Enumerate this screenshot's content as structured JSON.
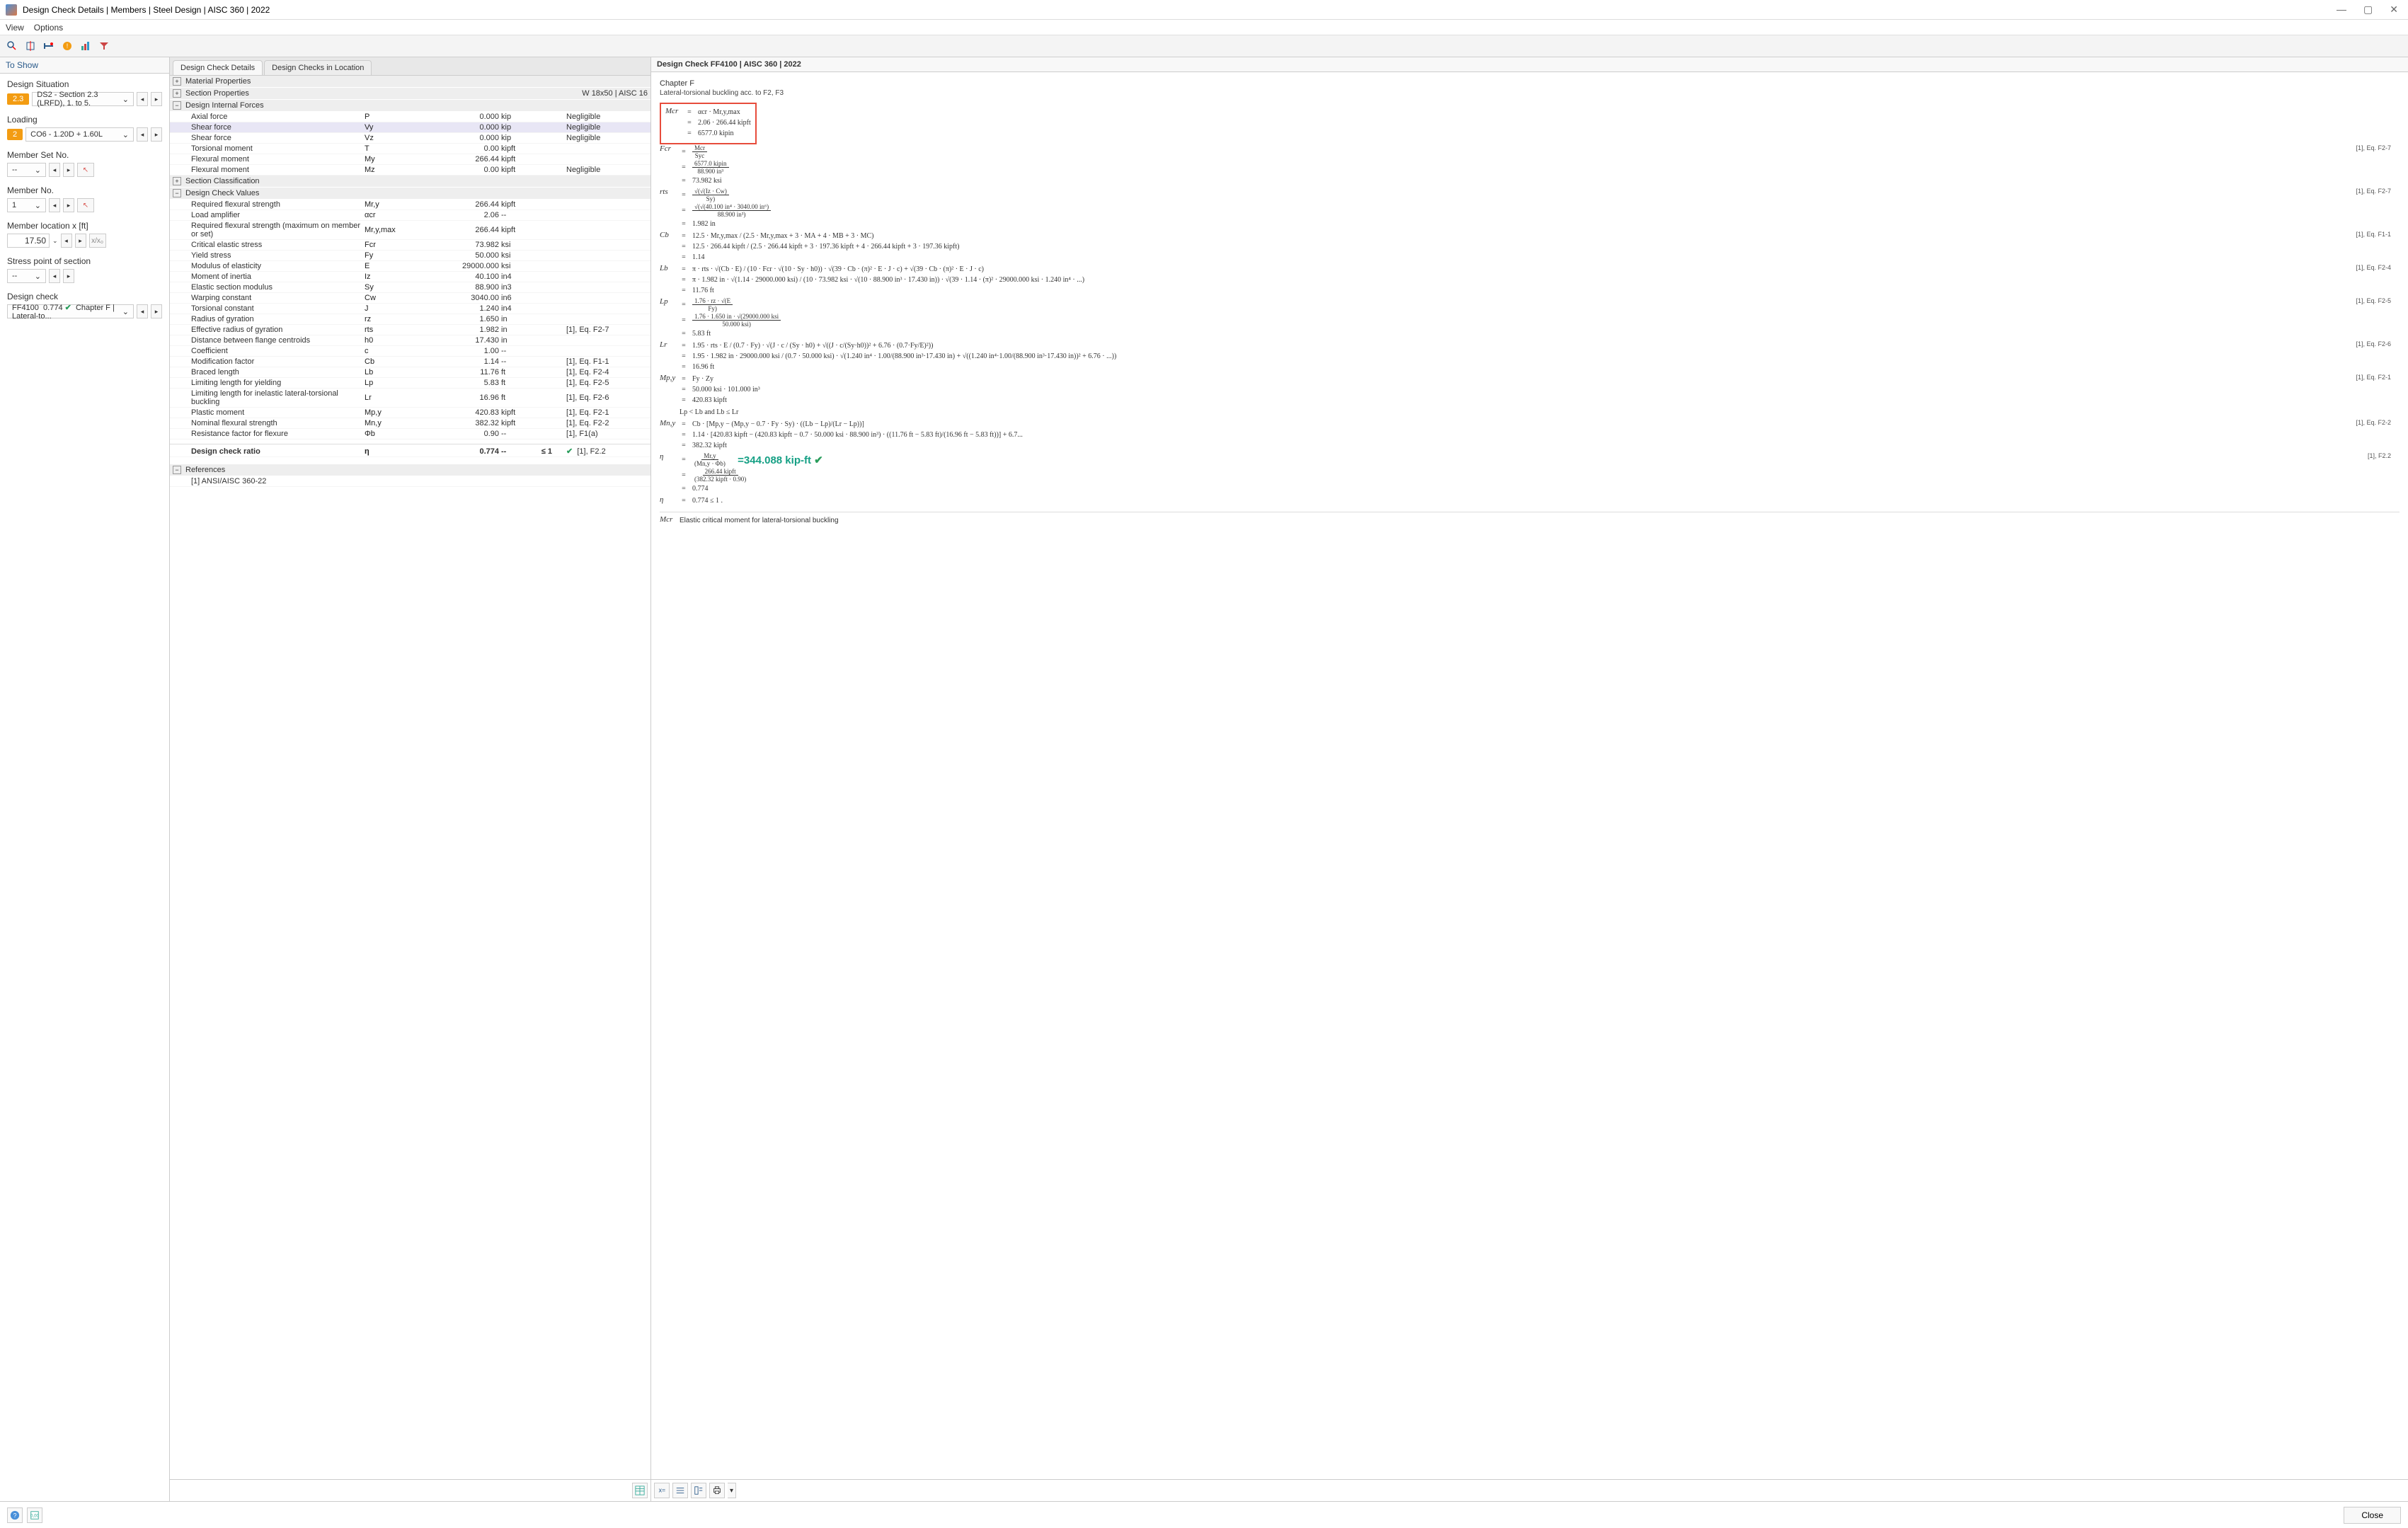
{
  "window": {
    "title": "Design Check Details | Members | Steel Design | AISC 360 | 2022"
  },
  "menu": {
    "view": "View",
    "options": "Options"
  },
  "sidebar": {
    "header": "To Show",
    "design_situation": {
      "label": "Design Situation",
      "chip": "2.3",
      "value": "DS2 - Section 2.3 (LRFD), 1. to 5."
    },
    "loading": {
      "label": "Loading",
      "chip": "2",
      "value": "CO6 - 1.20D + 1.60L"
    },
    "member_set": {
      "label": "Member Set No.",
      "value": "-- "
    },
    "member_no": {
      "label": "Member No.",
      "value": "1 "
    },
    "location": {
      "label": "Member location x [ft]",
      "value": "17.50"
    },
    "stress_point": {
      "label": "Stress point of section",
      "value": "-- "
    },
    "design_check": {
      "label": "Design check",
      "code": "FF4100",
      "ratio": "0.774",
      "desc": "Chapter F | Lateral-to..."
    }
  },
  "center": {
    "tabs": [
      "Design Check Details",
      "Design Checks in Location"
    ],
    "sections": {
      "material": "Material Properties",
      "section": "Section Properties",
      "section_right": "W 18x50 | AISC 16",
      "internal_forces": "Design Internal Forces",
      "section_class": "Section Classification",
      "check_values": "Design Check Values",
      "references": "References"
    },
    "internal_forces_rows": [
      {
        "label": "Axial force",
        "sym": "P",
        "val": "0.000",
        "unit": "kip",
        "note": "Negligible"
      },
      {
        "label": "Shear force",
        "sym": "Vy",
        "val": "0.000",
        "unit": "kip",
        "note": "Negligible",
        "hl": true
      },
      {
        "label": "Shear force",
        "sym": "Vz",
        "val": "0.000",
        "unit": "kip",
        "note": "Negligible"
      },
      {
        "label": "Torsional moment",
        "sym": "T",
        "val": "0.00",
        "unit": "kipft",
        "note": ""
      },
      {
        "label": "Flexural moment",
        "sym": "My",
        "val": "266.44",
        "unit": "kipft",
        "note": ""
      },
      {
        "label": "Flexural moment",
        "sym": "Mz",
        "val": "0.00",
        "unit": "kipft",
        "note": "Negligible"
      }
    ],
    "check_values_rows": [
      {
        "label": "Required flexural strength",
        "sym": "Mr,y",
        "val": "266.44",
        "unit": "kipft",
        "ref": ""
      },
      {
        "label": "Load amplifier",
        "sym": "αcr",
        "val": "2.06",
        "unit": "--",
        "ref": ""
      },
      {
        "label": "Required flexural strength (maximum on member or set)",
        "sym": "Mr,y,max",
        "val": "266.44",
        "unit": "kipft",
        "ref": ""
      },
      {
        "label": "Critical elastic stress",
        "sym": "Fcr",
        "val": "73.982",
        "unit": "ksi",
        "ref": ""
      },
      {
        "label": "Yield stress",
        "sym": "Fy",
        "val": "50.000",
        "unit": "ksi",
        "ref": ""
      },
      {
        "label": "Modulus of elasticity",
        "sym": "E",
        "val": "29000.000",
        "unit": "ksi",
        "ref": ""
      },
      {
        "label": "Moment of inertia",
        "sym": "Iz",
        "val": "40.100",
        "unit": "in4",
        "ref": ""
      },
      {
        "label": "Elastic section modulus",
        "sym": "Sy",
        "val": "88.900",
        "unit": "in3",
        "ref": ""
      },
      {
        "label": "Warping constant",
        "sym": "Cw",
        "val": "3040.00",
        "unit": "in6",
        "ref": ""
      },
      {
        "label": "Torsional constant",
        "sym": "J",
        "val": "1.240",
        "unit": "in4",
        "ref": ""
      },
      {
        "label": "Radius of gyration",
        "sym": "rz",
        "val": "1.650",
        "unit": "in",
        "ref": ""
      },
      {
        "label": "Effective radius of gyration",
        "sym": "rts",
        "val": "1.982",
        "unit": "in",
        "ref": "[1], Eq. F2-7"
      },
      {
        "label": "Distance between flange centroids",
        "sym": "h0",
        "val": "17.430",
        "unit": "in",
        "ref": ""
      },
      {
        "label": "Coefficient",
        "sym": "c",
        "val": "1.00",
        "unit": "--",
        "ref": ""
      },
      {
        "label": "Modification factor",
        "sym": "Cb",
        "val": "1.14",
        "unit": "--",
        "ref": "[1], Eq. F1-1"
      },
      {
        "label": "Braced length",
        "sym": "Lb",
        "val": "11.76",
        "unit": "ft",
        "ref": "[1], Eq. F2-4"
      },
      {
        "label": "Limiting length for yielding",
        "sym": "Lp",
        "val": "5.83",
        "unit": "ft",
        "ref": "[1], Eq. F2-5"
      },
      {
        "label": "Limiting length for inelastic lateral-torsional buckling",
        "sym": "Lr",
        "val": "16.96",
        "unit": "ft",
        "ref": "[1], Eq. F2-6"
      },
      {
        "label": "Plastic moment",
        "sym": "Mp,y",
        "val": "420.83",
        "unit": "kipft",
        "ref": "[1], Eq. F2-1"
      },
      {
        "label": "Nominal flexural strength",
        "sym": "Mn,y",
        "val": "382.32",
        "unit": "kipft",
        "ref": "[1], Eq. F2-2"
      },
      {
        "label": "Resistance factor for flexure",
        "sym": "Φb",
        "val": "0.90",
        "unit": "--",
        "ref": "[1], F1(a)"
      }
    ],
    "ratio": {
      "label": "Design check ratio",
      "sym": "η",
      "val": "0.774",
      "unit": "--",
      "limit": "≤ 1",
      "ref": "[1], F2.2"
    },
    "reference": "[1]  ANSI/AISC 360-22"
  },
  "right": {
    "header": "Design Check FF4100 | AISC 360 | 2022",
    "subtitle": "Chapter F",
    "subdesc": "Lateral-torsional buckling acc. to F2, F3",
    "boxed": {
      "lhs": "Mcr",
      "l1": "αcr · Mr,y,max",
      "l2": "2.06 · 266.44 kipft",
      "l3": "6577.0 kipin"
    },
    "eqs": [
      {
        "lhs": "Fcr",
        "ref": "[1], Eq. F2-7",
        "lines": [
          "Mcr / Syc",
          "6577.0 kipin / 88.900 in³",
          "73.982 ksi"
        ]
      },
      {
        "lhs": "rts",
        "ref": "[1], Eq. F2-7",
        "lines": [
          "√(√(Iz · Cw) / Sy)",
          "√(√(40.100 in⁴ · 3040.00 in⁶) / 88.900 in³)",
          "1.982 in"
        ]
      },
      {
        "lhs": "Cb",
        "ref": "[1], Eq. F1-1",
        "lines": [
          "12.5 · Mr,y,max / (2.5 · Mr,y,max + 3 · MA + 4 · MB + 3 · MC)",
          "12.5 · 266.44 kipft / (2.5 · 266.44 kipft + 3 · 197.36 kipft + 4 · 266.44 kipft + 3 · 197.36 kipft)",
          "1.14"
        ]
      },
      {
        "lhs": "Lb",
        "ref": "[1], Eq. F2-4",
        "lines": [
          "π · rts · √(Cb · E) / (10 · Fcr · √(10 · Sy · h0)) · √(39 · Cb · (π)² · E · J · c) + √(39 · Cb · (π)² · E · J · c)",
          "π · 1.982 in · √(1.14 · 29000.000 ksi) / (10 · 73.982 ksi · √(10 · 88.900 in³ · 17.430 in)) · √(39 · 1.14 · (π)² · 29000.000 ksi · 1.240 in⁴ · ...)",
          "11.76 ft"
        ]
      },
      {
        "lhs": "Lp",
        "ref": "[1], Eq. F2-5",
        "lines": [
          "1.76 · rz · √(E / Fy)",
          "1.76 · 1.650 in · √(29000.000 ksi / 50.000 ksi)",
          "5.83 ft"
        ]
      },
      {
        "lhs": "Lr",
        "ref": "[1], Eq. F2-6",
        "lines": [
          "1.95 · rts · E / (0.7 · Fy) · √(J · c / (Sy · h0) + √((J · c/(Sy·h0))² + 6.76 · (0.7·Fy/E)²))",
          "1.95 · 1.982 in · 29000.000 ksi / (0.7 · 50.000 ksi) · √(1.240 in⁴ · 1.00/(88.900 in³·17.430 in) + √((1.240 in⁴·1.00/(88.900 in³·17.430 in))² + 6.76 · ...))",
          "16.96 ft"
        ]
      },
      {
        "lhs": "Mp,y",
        "ref": "[1], Eq. F2-1",
        "lines": [
          "Fy · Zy",
          "50.000 ksi · 101.000 in³",
          "420.83 kipft"
        ]
      },
      {
        "lhs": "",
        "ref": "",
        "cond": "Lp < Lb and Lb ≤ Lr"
      },
      {
        "lhs": "Mn,y",
        "ref": "[1], Eq. F2-2",
        "lines": [
          "Cb · [Mp,y − (Mp,y − 0.7 · Fy · Sy) · ((Lb − Lp)/(Lr − Lp))]",
          "1.14 · [420.83 kipft − (420.83 kipft − 0.7 · 50.000 ksi · 88.900 in³) · ((11.76 ft − 5.83 ft)/(16.96 ft − 5.83 ft))] + 6.7...",
          "382.32 kipft"
        ]
      },
      {
        "lhs": "η",
        "ref": "[1], F2.2",
        "lines": [
          "Mr,y / (Mn,y · Φb)",
          "266.44 kipft / (382.32 kipft · 0.90)",
          "0.774"
        ],
        "callout": "=344.088 kip-ft"
      },
      {
        "lhs": "η",
        "ref": "",
        "lines": [
          "0.774 ≤ 1 ."
        ]
      }
    ],
    "footnote": {
      "lhs": "Mcr",
      "txt": "Elastic critical moment for lateral-torsional buckling"
    }
  },
  "footer": {
    "close": "Close"
  }
}
